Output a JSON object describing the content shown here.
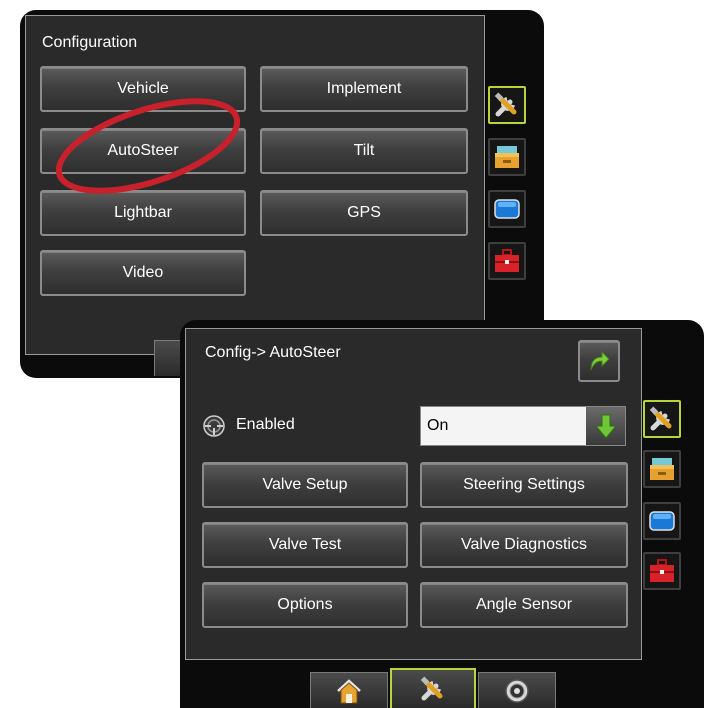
{
  "back_screen": {
    "title": "Configuration",
    "buttons": [
      "Vehicle",
      "Implement",
      "AutoSteer",
      "Tilt",
      "Lightbar",
      "GPS",
      "Video"
    ],
    "highlight_color": "#c8212b",
    "side_icons": [
      "tools-icon",
      "console-icon",
      "screen-icon",
      "toolbox-icon"
    ]
  },
  "front_screen": {
    "title": "Config-> AutoSteer",
    "enabled_label": "Enabled",
    "enabled_value": "On",
    "buttons": [
      "Valve Setup",
      "Steering Settings",
      "Valve Test",
      "Valve Diagnostics",
      "Options",
      "Angle Sensor"
    ],
    "side_icons": [
      "tools-icon",
      "console-icon",
      "screen-icon",
      "toolbox-icon"
    ],
    "bottom_tabs": [
      "home-icon",
      "tools-icon",
      "gauge-icon"
    ],
    "accent": "#b8d43b"
  }
}
